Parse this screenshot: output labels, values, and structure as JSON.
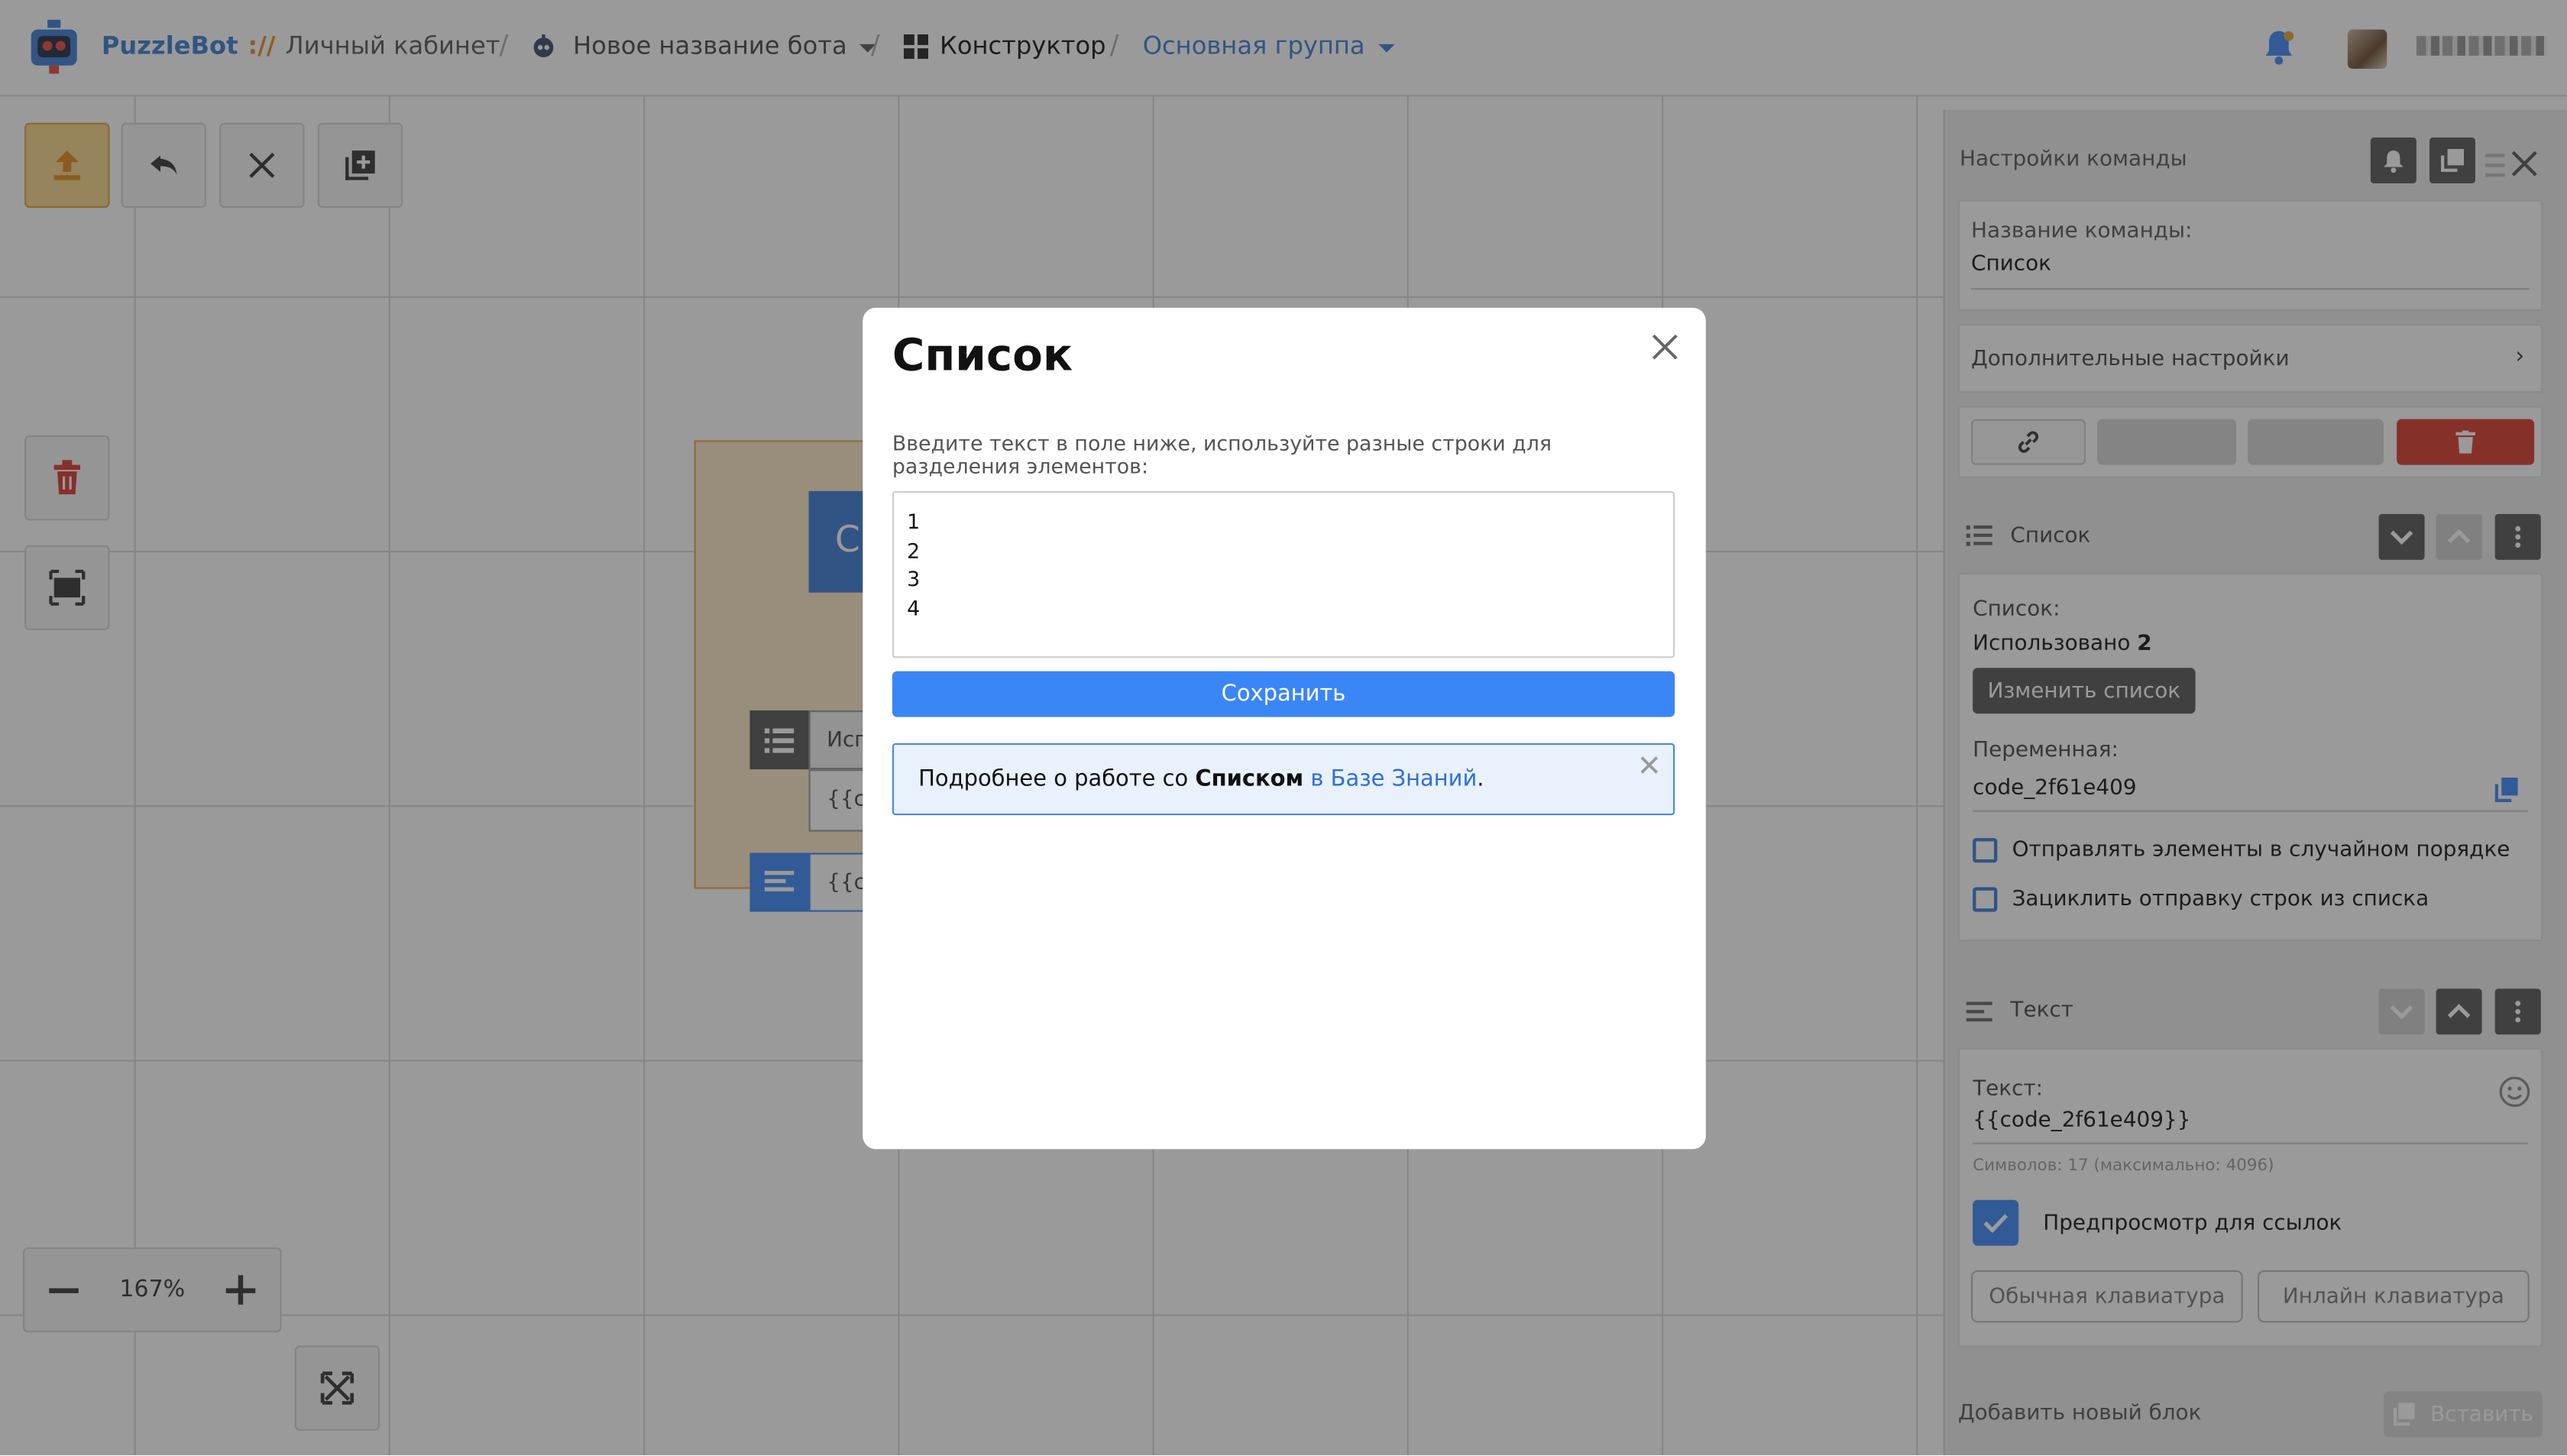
{
  "header": {
    "brand": "PuzzleBot",
    "brand_sep": "://",
    "cabinet": "Личный кабинет",
    "bot_name": "Новое название бота",
    "constructor": "Конструктор",
    "group": "Основная группа"
  },
  "canvas": {
    "zoom": "167%",
    "block_title_fragment": "Сп",
    "row1_text": "Исп",
    "row2_text": "{{co",
    "row3_text": "{{co"
  },
  "panel": {
    "title": "Настройки команды",
    "command_name_label": "Название команды:",
    "command_name_value": "Список",
    "extra_settings": "Дополнительные настройки",
    "list_section_title": "Список",
    "list_label": "Список:",
    "used_prefix": "Использовано",
    "used_count": "2",
    "change_list": "Изменить список",
    "variable_label": "Переменная:",
    "variable_value": "code_2f61e409",
    "random_order": "Отправлять элементы в случайном порядке",
    "loop_send": "Зациклить отправку строк из списка",
    "text_section_title": "Текст",
    "text_label": "Текст:",
    "text_value": "{{code_2f61e409}}",
    "symbols": "Символов: 17 (максимально: 4096)",
    "link_preview": "Предпросмотр для ссылок",
    "regular_kb": "Обычная клавиатура",
    "inline_kb": "Инлайн клавиатура",
    "add_block": "Добавить новый блок",
    "paste": "Вставить"
  },
  "modal": {
    "title": "Список",
    "hint": "Введите текст в поле ниже, используйте разные строки для разделения элементов:",
    "lines": [
      "1",
      "2",
      "3",
      "4"
    ],
    "save": "Сохранить",
    "info_prefix": "Подробнее о работе со ",
    "info_bold": "Списком",
    "info_link": "в Базе Знаний",
    "info_suffix": "."
  },
  "colors": {
    "accent": "#3a86f7",
    "brand": "#3a7bd5",
    "danger": "#d9382c",
    "highlight": "#f6d58a"
  }
}
